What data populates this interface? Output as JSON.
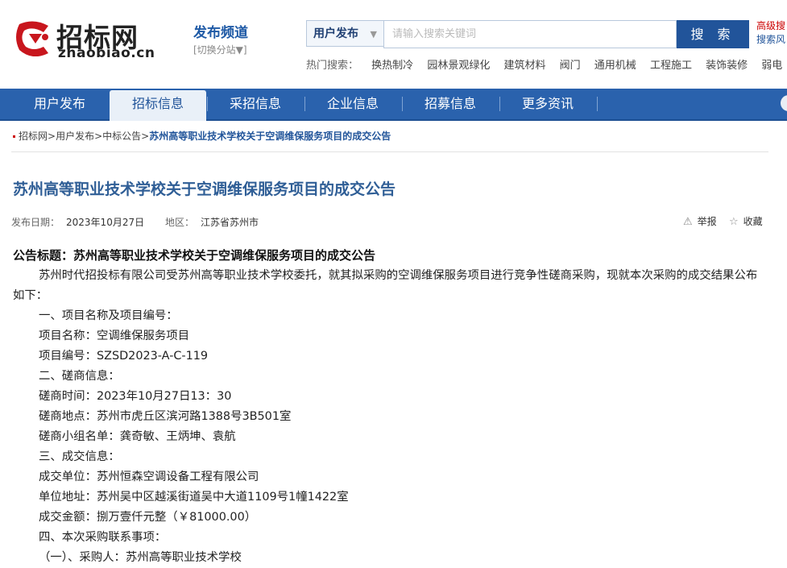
{
  "brand": {
    "name_cn": "招标网",
    "name_en": "zhaobiao.cn",
    "color": "#c8161d"
  },
  "channel": {
    "title": "发布频道",
    "switch": "[切换分站▼]"
  },
  "search": {
    "type_label": "用户发布",
    "type_arrow": "▼",
    "placeholder": "请输入搜索关键词",
    "button": "搜 索",
    "advanced": "高级搜",
    "advanced2": "搜索风"
  },
  "hot": {
    "label": "热门搜索：",
    "items": [
      "换热制冷",
      "园林景观绿化",
      "建筑材料",
      "阀门",
      "通用机械",
      "工程施工",
      "装饰装修",
      "弱电"
    ]
  },
  "nav": {
    "items": [
      "用户发布",
      "招标信息",
      "采招信息",
      "企业信息",
      "招募信息",
      "更多资讯"
    ],
    "active_index": 1,
    "color": "#2a62ad"
  },
  "breadcrumb": {
    "items": [
      "招标网",
      "用户发布",
      "中标公告"
    ],
    "separator": ">",
    "current": "苏州高等职业技术学校关于空调维保服务项目的成交公告"
  },
  "doc": {
    "title": "苏州高等职业技术学校关于空调维保服务项目的成交公告",
    "date_label": "发布日期：",
    "date": "2023年10月27日",
    "region_label": "地区：",
    "region": "江苏省苏州市",
    "report": "举报",
    "favorite": "收藏",
    "body_title": "公告标题：苏州高等职业技术学校关于空调维保服务项目的成交公告",
    "intro": "苏州时代招投标有限公司受苏州高等职业技术学校委托，就其拟采购的空调维保服务项目进行竞争性磋商采购，现就本次采购的成交结果公布如下：",
    "lines": [
      "一、项目名称及项目编号：",
      "项目名称：空调维保服务项目",
      "项目编号：SZSD2023-A-C-119",
      "二、磋商信息：",
      "磋商时间：2023年10月27日13：30",
      "磋商地点：苏州市虎丘区滨河路1388号3B501室",
      "磋商小组名单：龚奇敏、王炳坤、袁航",
      "三、成交信息：",
      "成交单位：苏州恒森空调设备工程有限公司",
      "单位地址：苏州吴中区越溪街道吴中大道1109号1幢1422室",
      "成交金额：捌万壹仟元整（￥81000.00）",
      "四、本次采购联系事项：",
      "（一）、采购人：苏州高等职业技术学校"
    ]
  }
}
